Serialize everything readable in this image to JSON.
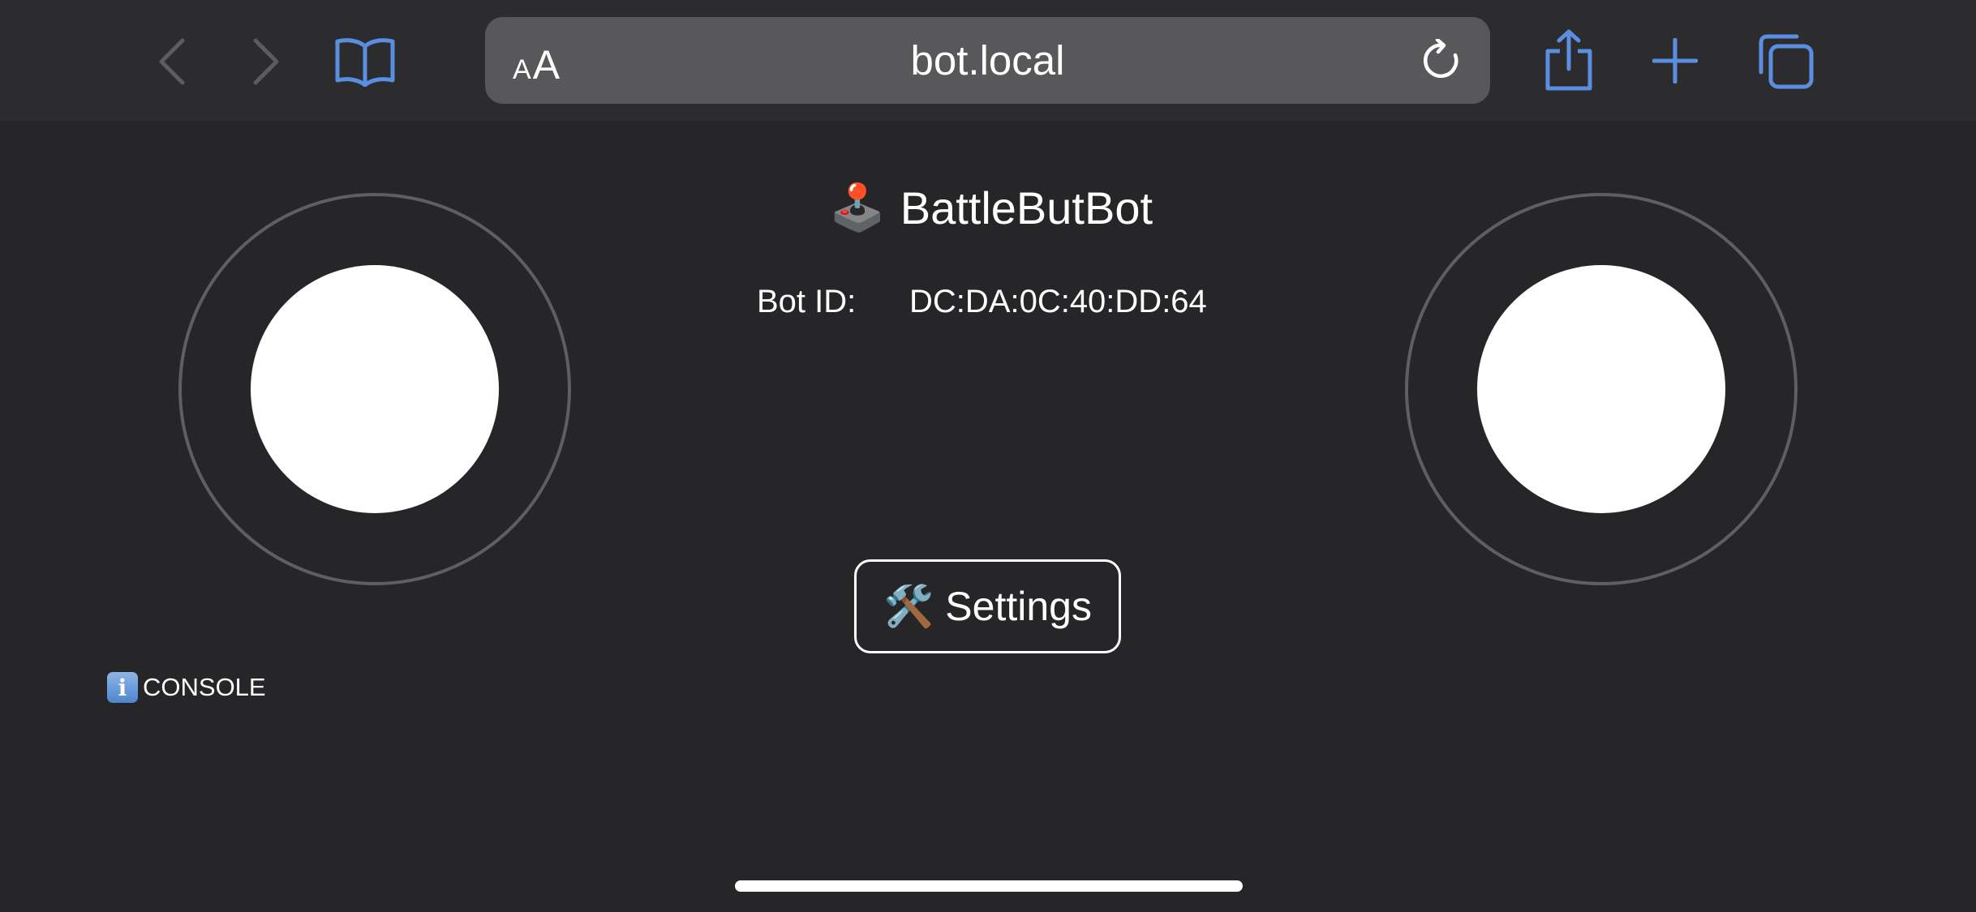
{
  "browser": {
    "text_size_button": {
      "small": "A",
      "big": "A"
    },
    "url": "bot.local",
    "icons": {
      "back": "chevron-left-icon",
      "forward": "chevron-right-icon",
      "bookmarks": "book-icon",
      "reload": "reload-icon",
      "share": "share-icon",
      "new_tab": "plus-icon",
      "tabs": "tabs-icon"
    },
    "accent_color": "#5a8ee0"
  },
  "page": {
    "title_emoji": "🕹️",
    "title": "BattleButBot",
    "bot_id_label": "Bot ID:",
    "bot_id_value": "DC:DA:0C:40:DD:64",
    "settings_emoji": "🛠️",
    "settings_label": "Settings",
    "console_icon": "i",
    "console_label": "CONSOLE"
  }
}
